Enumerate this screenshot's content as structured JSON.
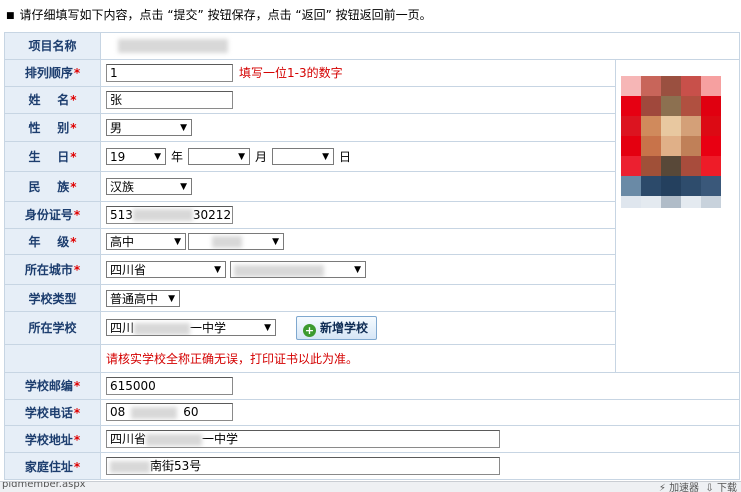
{
  "instruction": "请仔细填写如下内容，点击 “提交” 按钮保存，点击 “返回” 按钮返回前一页。",
  "fields": {
    "project_name": {
      "label": "项目名称"
    },
    "rank": {
      "label": "排列顺序",
      "value": "1",
      "hint": "填写一位1-3的数字"
    },
    "name": {
      "label": "姓    名",
      "value": "张"
    },
    "gender": {
      "label": "性    别",
      "value": "男"
    },
    "birth": {
      "label": "生    日",
      "year": "19",
      "year_unit": "年",
      "month_unit": "月",
      "day_unit": "日"
    },
    "ethnicity": {
      "label": "民    族",
      "value": "汉族"
    },
    "id_number": {
      "label": "身份证号",
      "prefix": "513",
      "suffix": "30212"
    },
    "grade": {
      "label": "年    级",
      "value": "高中"
    },
    "city": {
      "label": "所在城市",
      "province": "四川省"
    },
    "school_type": {
      "label": "学校类型",
      "value": "普通高中"
    },
    "school": {
      "label": "所在学校",
      "prefix": "四川",
      "suffix": "一中学",
      "add_button": "新增学校"
    },
    "notice": "请核实学校全称正确无误，打印证书以此为准。",
    "zip": {
      "label": "学校邮编",
      "value": "615000"
    },
    "phone": {
      "label": "学校电话",
      "prefix": "08",
      "suffix": "60"
    },
    "school_address": {
      "label": "学校地址",
      "prefix": "四川省",
      "suffix": "一中学"
    },
    "home_address": {
      "label": "家庭住址",
      "suffix": "南街53号"
    }
  },
  "status_bar": {
    "url": "pldmember.aspx",
    "accel": "加速器",
    "download": "下载"
  },
  "colors": {
    "label_bg": "#e6eef7",
    "label_text": "#1c3d6e",
    "border": "#c7d5e3",
    "required": "#e00000"
  }
}
